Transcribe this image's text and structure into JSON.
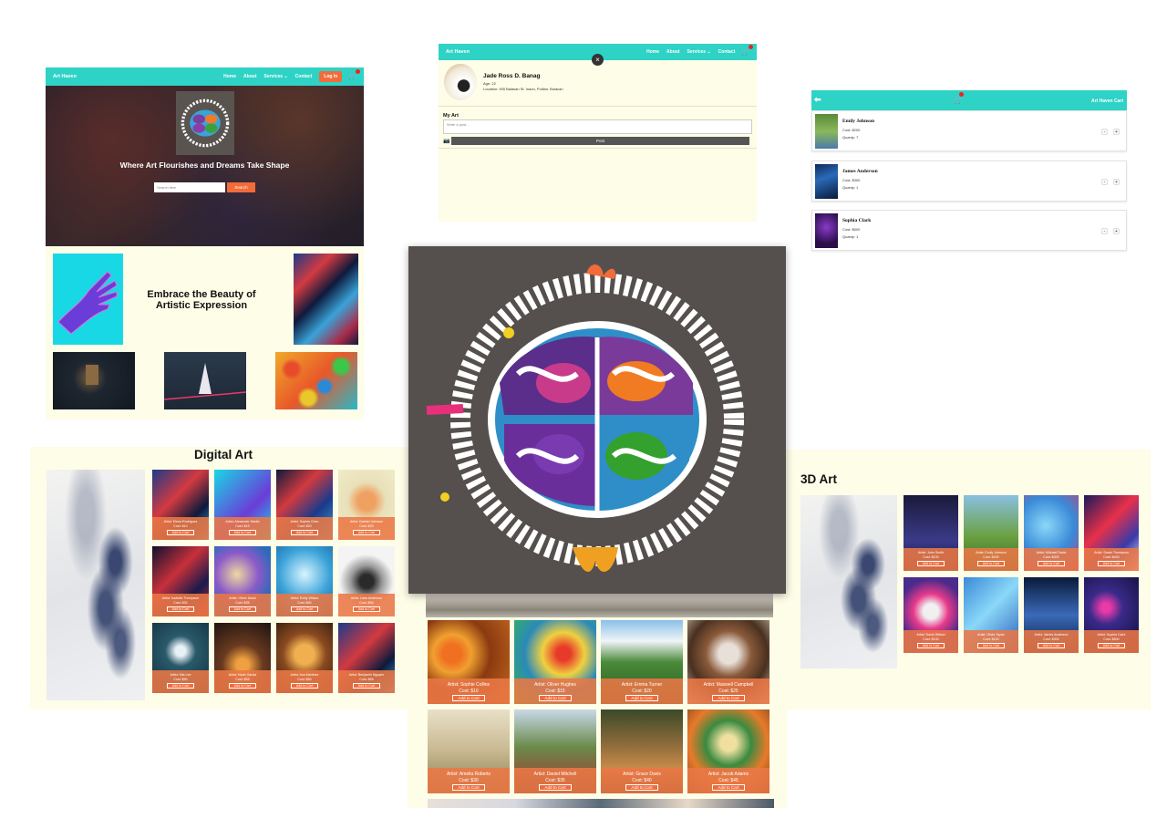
{
  "home": {
    "brand": "Art Haven",
    "nav": [
      "Home",
      "About",
      "Services ⌄",
      "Contact"
    ],
    "login_label": "Log In",
    "hero_title": "Where Art Flourishes and Dreams Take Shape",
    "search_placeholder": "Search item",
    "search_button": "Search",
    "embrace_text": "Embrace the Beauty of Artistic Expression"
  },
  "profile": {
    "brand": "Art Haven",
    "nav": [
      "Home",
      "About",
      "Services ⌄",
      "Contact"
    ],
    "close": "×",
    "name": "Jade Ross D. Banag",
    "age": "Age: 22",
    "location": "Location: 905 Balasan St. Inaon, Pulilan, Bulacan",
    "my_art": "My Art",
    "post_placeholder": "Write a post...",
    "post_button": "Post"
  },
  "cart": {
    "title": "Art Haven Cart",
    "items": [
      {
        "name": "Emily Johnson",
        "cost": "Cost: $200",
        "qty": "Quanty: 7"
      },
      {
        "name": "James Anderson",
        "cost": "Cost: $300",
        "qty": "Quanty: 1"
      },
      {
        "name": "Sophia Clark",
        "cost": "Cost: $500",
        "qty": "Quanty: 1"
      }
    ],
    "minus": "-",
    "plus": "+"
  },
  "digital": {
    "title": "Digital Art",
    "add_label": "Add to Cart",
    "cards": [
      {
        "artist": "Artist: Elena Rodriguez",
        "cost": "Cost: $10"
      },
      {
        "artist": "Artist: Alexander Martin",
        "cost": "Cost: $15"
      },
      {
        "artist": "Artist: Sophia Chen",
        "cost": "Cost: $20"
      },
      {
        "artist": "Artist: Gabriel Johnson",
        "cost": "Cost: $25"
      },
      {
        "artist": "Artist: Isabella Thompson",
        "cost": "Cost: $30"
      },
      {
        "artist": "Artist: Oliver Davis",
        "cost": "Cost: $35"
      },
      {
        "artist": "Artist: Emily Wilson",
        "cost": "Cost: $40"
      },
      {
        "artist": "Artist: Liam Anderson",
        "cost": "Cost: $45"
      },
      {
        "artist": "Artist: Mia Lee",
        "cost": "Cost: $50"
      },
      {
        "artist": "Artist: Noah Garcia",
        "cost": "Cost: $55"
      },
      {
        "artist": "Artist: Ava Martinez",
        "cost": "Cost: $60"
      },
      {
        "artist": "Artist: Benjamin Nguyen",
        "cost": "Cost: $65"
      }
    ]
  },
  "threed": {
    "title": "3D Art",
    "add_label": "Add to Cart",
    "cards": [
      {
        "artist": "Artist: John Smith",
        "cost": "Cost: $100"
      },
      {
        "artist": "Artist: Emily Johnson",
        "cost": "Cost: $200"
      },
      {
        "artist": "Artist: Michael Davis",
        "cost": "Cost: $300"
      },
      {
        "artist": "Artist: Sarah Thompson",
        "cost": "Cost: $400"
      },
      {
        "artist": "Artist: David Wilson",
        "cost": "Cost: $100"
      },
      {
        "artist": "Artist: Olivia Taylor",
        "cost": "Cost: $100"
      },
      {
        "artist": "Artist: James Anderson",
        "cost": "Cost: $300"
      },
      {
        "artist": "Artist: Sophia Clark",
        "cost": "Cost: $500"
      }
    ]
  },
  "trad": {
    "add_label": "Add to Cart",
    "cards": [
      {
        "artist": "Artist: Sophie Collins",
        "cost": "Cost: $10"
      },
      {
        "artist": "Artist: Oliver Hughes",
        "cost": "Cost: $15"
      },
      {
        "artist": "Artist: Emma Turner",
        "cost": "Cost: $20"
      },
      {
        "artist": "Artist: Maxwell Campbell",
        "cost": "Cost: $25"
      },
      {
        "artist": "Artist: Amelia Roberts",
        "cost": "Cost: $30"
      },
      {
        "artist": "Artist: Daniel Mitchell",
        "cost": "Cost: $35"
      },
      {
        "artist": "Artist: Grace Davis",
        "cost": "Cost: $40"
      },
      {
        "artist": "Artist: Jacob Adams",
        "cost": "Cost: $45"
      }
    ]
  },
  "colors": {
    "teal": "#2ed3c6",
    "orange": "#f26b3a",
    "cream": "#fdfde8"
  },
  "icons": [
    "cart-icon",
    "camera-icon",
    "back-arrow-icon",
    "close-icon"
  ]
}
